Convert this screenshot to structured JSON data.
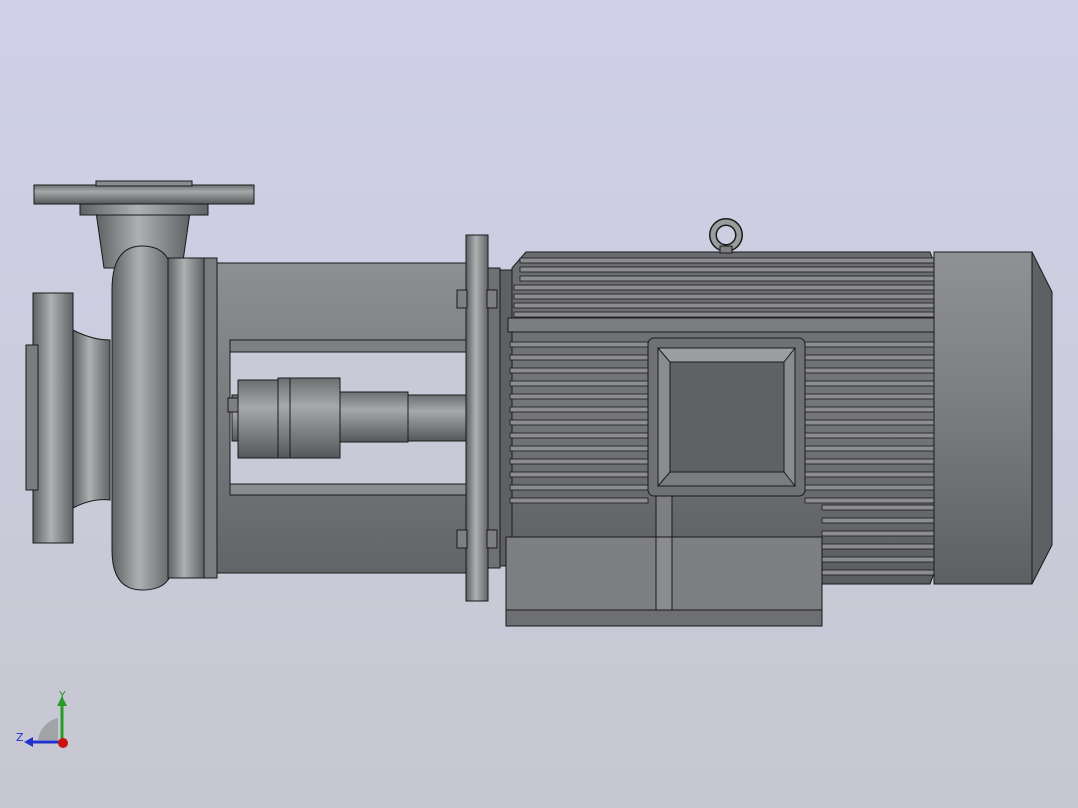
{
  "viewport": {
    "scene": "centrifugal-pump-assembly",
    "background_top": "#d0d1e9",
    "background_bottom": "#c6c7d0"
  },
  "model": {
    "parts": [
      "suction-flange",
      "volute-casing",
      "discharge-flange",
      "bearing-bracket",
      "shaft-coupling",
      "motor-flange",
      "motor-body",
      "motor-terminal-box",
      "motor-end-cap",
      "lifting-eye",
      "motor-base"
    ],
    "colors": {
      "metal_light": "#9a9c9e",
      "metal_mid": "#7d7f82",
      "metal_dark": "#5b5d60",
      "edge": "#1a1a1a"
    }
  },
  "triad": {
    "y_label": "Y",
    "z_label": "Z",
    "colors": {
      "y": "#2a9a2a",
      "z": "#2233cc",
      "x": "#cc1111"
    }
  }
}
